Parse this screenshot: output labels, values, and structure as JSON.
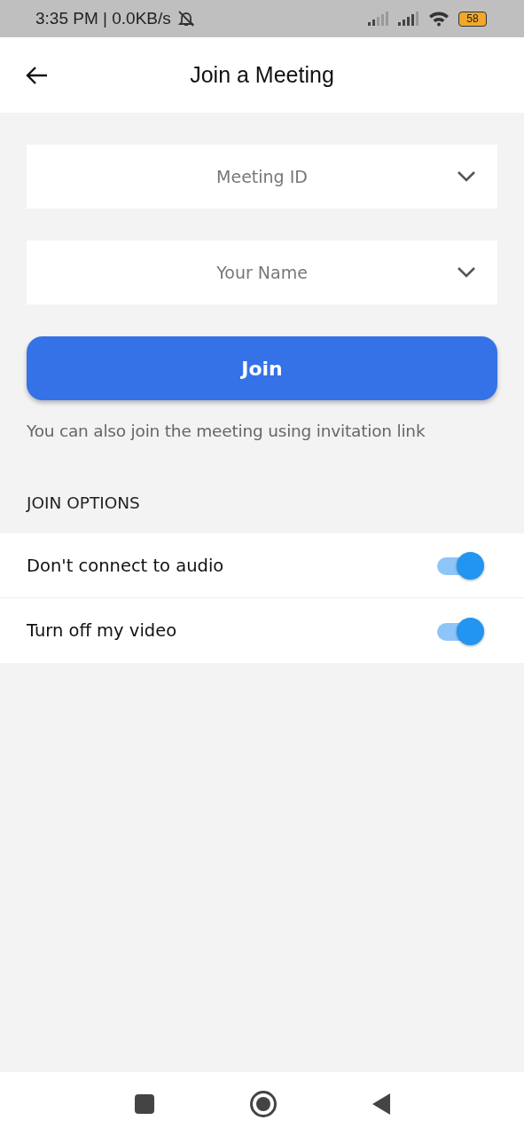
{
  "status_bar": {
    "time": "3:35 PM | 0.0KB/s",
    "battery": "58"
  },
  "app_bar": {
    "title": "Join a Meeting"
  },
  "fields": [
    {
      "placeholder": "Meeting ID"
    },
    {
      "placeholder": "Your Name"
    }
  ],
  "join_button": "Join",
  "hint": "You can also join the meeting using invitation link",
  "options_heading": "JOIN OPTIONS",
  "options": [
    {
      "label": "Don't connect to audio",
      "on": true
    },
    {
      "label": "Turn off my video",
      "on": true
    }
  ]
}
